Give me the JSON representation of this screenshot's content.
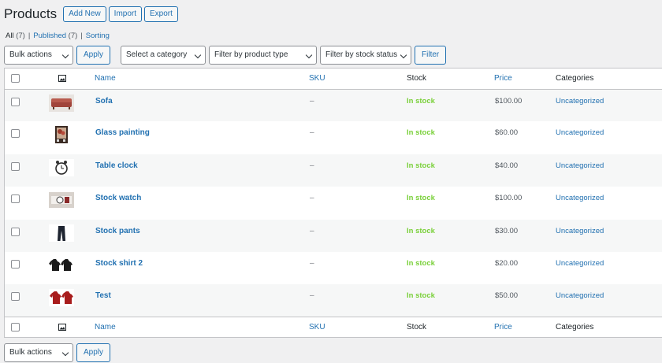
{
  "header": {
    "title": "Products",
    "add_new": "Add New",
    "import": "Import",
    "export": "Export"
  },
  "views": {
    "all": "All",
    "all_count": "(7)",
    "published": "Published",
    "published_count": "(7)",
    "sorting": "Sorting",
    "sep": "|"
  },
  "filters": {
    "bulk_actions": "Bulk actions",
    "apply": "Apply",
    "category": "Select a category",
    "product_type": "Filter by product type",
    "stock_status": "Filter by stock status",
    "filter": "Filter"
  },
  "columns": {
    "name": "Name",
    "sku": "SKU",
    "stock": "Stock",
    "price": "Price",
    "categories": "Categories"
  },
  "products": [
    {
      "name": "Sofa",
      "sku": "–",
      "stock": "In stock",
      "price": "$100.00",
      "category": "Uncategorized",
      "thumb": "sofa"
    },
    {
      "name": "Glass painting",
      "sku": "–",
      "stock": "In stock",
      "price": "$60.00",
      "category": "Uncategorized",
      "thumb": "painting"
    },
    {
      "name": "Table clock",
      "sku": "–",
      "stock": "In stock",
      "price": "$40.00",
      "category": "Uncategorized",
      "thumb": "clock"
    },
    {
      "name": "Stock watch",
      "sku": "–",
      "stock": "In stock",
      "price": "$100.00",
      "category": "Uncategorized",
      "thumb": "watch"
    },
    {
      "name": "Stock pants",
      "sku": "–",
      "stock": "In stock",
      "price": "$30.00",
      "category": "Uncategorized",
      "thumb": "pants"
    },
    {
      "name": "Stock shirt 2",
      "sku": "–",
      "stock": "In stock",
      "price": "$20.00",
      "category": "Uncategorized",
      "thumb": "shirts-black"
    },
    {
      "name": "Test",
      "sku": "–",
      "stock": "In stock",
      "price": "$50.00",
      "category": "Uncategorized",
      "thumb": "shirts-red"
    }
  ],
  "colors": {
    "accent": "#2271b1",
    "in_stock": "#7ad03a",
    "background": "#f0f0f1"
  }
}
